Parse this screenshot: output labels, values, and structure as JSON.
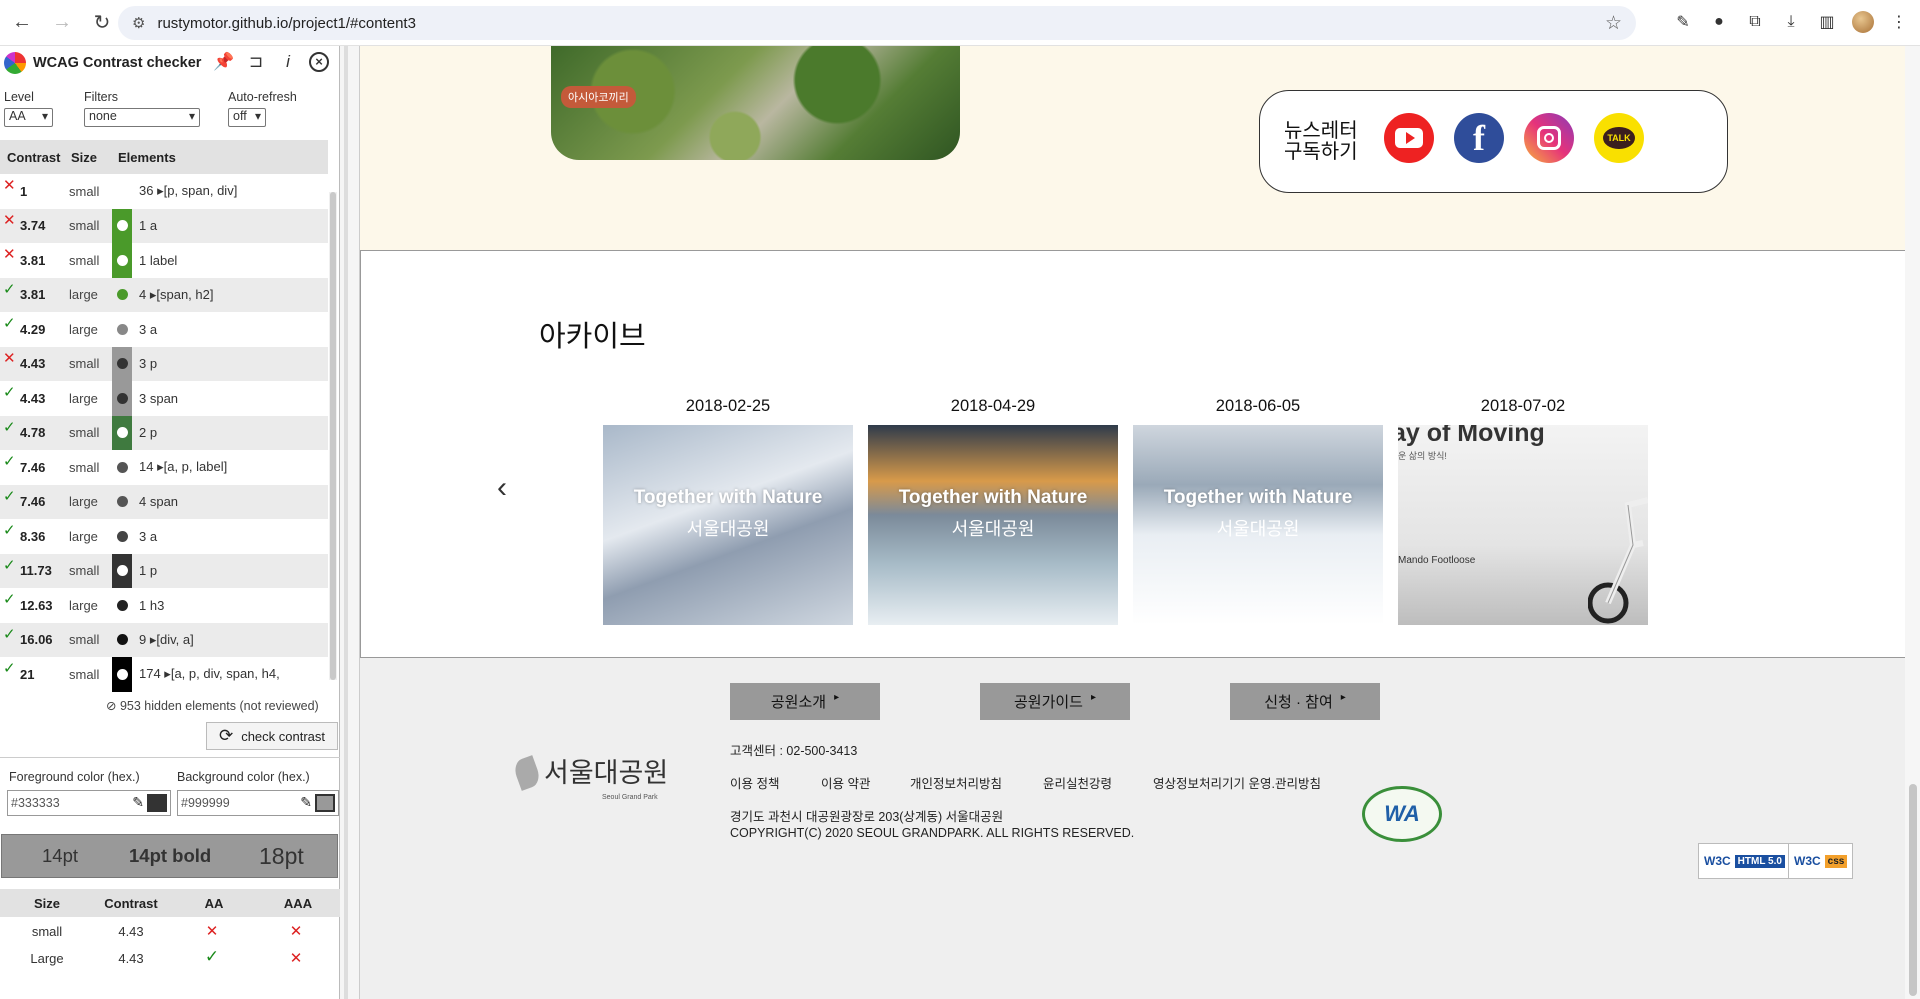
{
  "browser": {
    "url": "rustymotor.github.io/project1/#content3"
  },
  "panel": {
    "title": "WCAG Contrast checker",
    "level_label": "Level",
    "level_value": "AA",
    "filters_label": "Filters",
    "filters_value": "none",
    "autorefresh_label": "Auto-refresh",
    "autorefresh_value": "off",
    "columns": [
      "Contrast",
      "Size",
      "Elements"
    ],
    "rows": [
      {
        "status": "fail",
        "contrast": "1",
        "size": "small",
        "swatch_bg": "transparent",
        "dot": "transparent",
        "elements": "36 ▸[p, span, div]"
      },
      {
        "status": "fail",
        "contrast": "3.74",
        "size": "small",
        "swatch_bg": "#4a9a2a",
        "dot": "#ffffff",
        "elements": "1 a"
      },
      {
        "status": "fail",
        "contrast": "3.81",
        "size": "small",
        "swatch_bg": "#4a9a2a",
        "dot": "#ffffff",
        "elements": "1 label"
      },
      {
        "status": "pass",
        "contrast": "3.81",
        "size": "large",
        "swatch_bg": "transparent",
        "dot": "#4a9a2a",
        "elements": "4 ▸[span, h2]"
      },
      {
        "status": "pass",
        "contrast": "4.29",
        "size": "large",
        "swatch_bg": "transparent",
        "dot": "#888888",
        "elements": "3 a"
      },
      {
        "status": "fail",
        "contrast": "4.43",
        "size": "small",
        "swatch_bg": "#999999",
        "dot": "#333333",
        "elements": "3 p"
      },
      {
        "status": "pass",
        "contrast": "4.43",
        "size": "large",
        "swatch_bg": "#999999",
        "dot": "#333333",
        "elements": "3 span"
      },
      {
        "status": "pass",
        "contrast": "4.78",
        "size": "small",
        "swatch_bg": "#3f7a3f",
        "dot": "#ffffff",
        "elements": "2 p"
      },
      {
        "status": "pass",
        "contrast": "7.46",
        "size": "small",
        "swatch_bg": "transparent",
        "dot": "#555555",
        "elements": "14 ▸[a, p, label]"
      },
      {
        "status": "pass",
        "contrast": "7.46",
        "size": "large",
        "swatch_bg": "transparent",
        "dot": "#555555",
        "elements": "4 span"
      },
      {
        "status": "pass",
        "contrast": "8.36",
        "size": "large",
        "swatch_bg": "transparent",
        "dot": "#444444",
        "elements": "3 a"
      },
      {
        "status": "pass",
        "contrast": "11.73",
        "size": "small",
        "swatch_bg": "#333333",
        "dot": "#ffffff",
        "elements": "1 p"
      },
      {
        "status": "pass",
        "contrast": "12.63",
        "size": "large",
        "swatch_bg": "transparent",
        "dot": "#222222",
        "elements": "1 h3"
      },
      {
        "status": "pass",
        "contrast": "16.06",
        "size": "small",
        "swatch_bg": "transparent",
        "dot": "#111111",
        "elements": "9 ▸[div, a]"
      },
      {
        "status": "pass",
        "contrast": "21",
        "size": "small",
        "swatch_bg": "#000000",
        "dot": "#ffffff",
        "elements": "174 ▸[a, p, div, span, h4,"
      }
    ],
    "hidden_note": "953 hidden elements (not reviewed)",
    "check_button": "check contrast",
    "fg_label": "Foreground color (hex.)",
    "fg_value": "#333333",
    "bg_label": "Background color (hex.)",
    "bg_value": "#999999",
    "preview": [
      "14pt",
      "14pt bold",
      "18pt"
    ],
    "result_columns": [
      "Size",
      "Contrast",
      "AA",
      "AAA"
    ],
    "results": [
      {
        "size": "small",
        "contrast": "4.43",
        "aa": "fail",
        "aaa": "fail"
      },
      {
        "size": "Large",
        "contrast": "4.43",
        "aa": "pass",
        "aaa": "fail"
      }
    ]
  },
  "page": {
    "hero_tag": "아시아코끼리",
    "newsletter_label": "뉴스레터 구독하기",
    "sns": [
      "youtube",
      "facebook",
      "instagram",
      "kakaotalk"
    ],
    "kakao_text": "TALK",
    "facebook_glyph": "f",
    "archive_title": "아카이브",
    "cards": [
      {
        "date": "2018-02-25",
        "caption1": "Together with Nature",
        "caption2": "서울대공원"
      },
      {
        "date": "2018-04-29",
        "caption1": "Together with Nature",
        "caption2": "서울대공원"
      },
      {
        "date": "2018-06-05",
        "caption1": "Together with Nature",
        "caption2": "서울대공원"
      },
      {
        "date": "2018-07-02",
        "caption1": "ay of Moving",
        "caption2": "운 삶의 방식!",
        "brand": "Mando Footloose"
      }
    ],
    "prev_arrow": "‹",
    "next_arrow": "›",
    "footer": {
      "buttons": [
        "공원소개",
        "공원가이드",
        "신청 · 참여"
      ],
      "logo_name": "서울대공원",
      "logo_en": "Seoul Grand Park",
      "phone": "고객센터 : 02-500-3413",
      "links": [
        "이용 정책",
        "이용 약관",
        "개인정보처리방침",
        "윤리실천강령",
        "영상정보처리기기 운영.관리방침"
      ],
      "address": "경기도 과천시 대공원광장로 203(상계동) 서울대공원",
      "copyright": "COPYRIGHT(C) 2020 SEOUL GRANDPARK. ALL RIGHTS RESERVED.",
      "wa_mark": "WA",
      "w3c_html": [
        "W3C",
        "HTML 5.0"
      ],
      "w3c_css": [
        "W3C",
        "css"
      ]
    }
  }
}
